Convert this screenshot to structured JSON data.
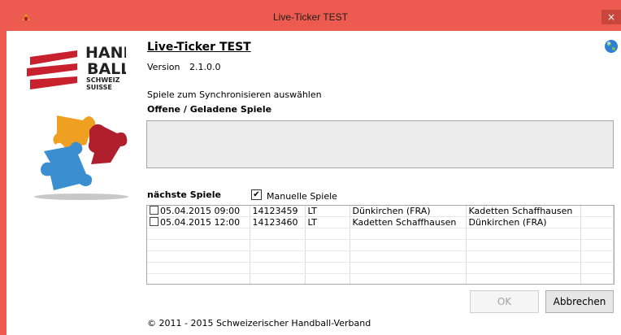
{
  "window": {
    "title": "Live-Ticker TEST",
    "close_label": "×"
  },
  "header": {
    "app_title": "Live-Ticker TEST",
    "version_label": "Version",
    "version_value": "2.1.0.0"
  },
  "logo": {
    "lines": [
      "HAND",
      "BALL",
      "SCHWEIZ",
      "SUISSE"
    ]
  },
  "open_games": {
    "select_instruction": "Spiele zum Synchronisieren auswählen",
    "heading": "Offene / Geladene Spiele",
    "items": []
  },
  "next_games": {
    "heading": "nächste Spiele",
    "manual_label": "Manuelle Spiele",
    "manual_checked": true,
    "checkmark": "✔",
    "rows": [
      {
        "checked": false,
        "date": "05.04.2015 09:00",
        "id": "14123459",
        "type": "LT",
        "home": "Dünkirchen (FRA)",
        "away": "Kadetten Schaffhausen"
      },
      {
        "checked": false,
        "date": "05.04.2015 12:00",
        "id": "14123460",
        "type": "LT",
        "home": "Kadetten Schaffhausen",
        "away": "Dünkirchen (FRA)"
      }
    ],
    "empty_row_count": 5
  },
  "buttons": {
    "ok_label": "OK",
    "ok_enabled": false,
    "cancel_label": "Abbrechen"
  },
  "footer": {
    "copyright": "© 2011 - 2015 Schweizerischer Handball-Verband"
  },
  "icons": {
    "app": "app-logo-icon",
    "globe": "globe-icon",
    "close": "close-icon",
    "puzzle": "puzzle-illustration"
  },
  "colors": {
    "titlebar": "#ec5a50",
    "close_button": "#c9463d",
    "handball_red": "#c8202c",
    "puzzle_orange": "#f0a020",
    "puzzle_red": "#b0202c",
    "puzzle_blue": "#3b8fd0"
  }
}
